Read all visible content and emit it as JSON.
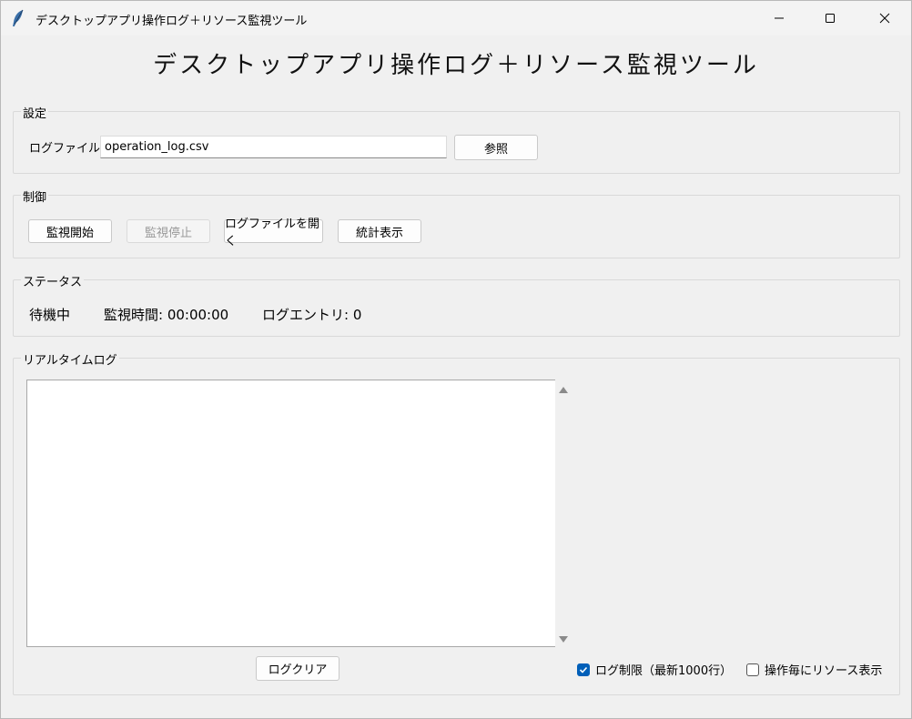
{
  "window": {
    "title": "デスクトップアプリ操作ログ＋リソース監視ツール"
  },
  "app_title": "デスクトップアプリ操作ログ＋リソース監視ツール",
  "settings": {
    "group_label": "設定",
    "logfile_label": "ログファイル:",
    "logfile_value": "operation_log.csv",
    "browse_label": "参照"
  },
  "control": {
    "group_label": "制御",
    "start_label": "監視開始",
    "stop_label": "監視停止",
    "open_log_label": "ログファイルを開く",
    "stats_label": "統計表示"
  },
  "status": {
    "group_label": "ステータス",
    "state": "待機中",
    "elapsed": "監視時間: 00:00:00",
    "entries": "ログエントリ: 0"
  },
  "realtime": {
    "group_label": "リアルタイムログ",
    "log_text": "",
    "clear_label": "ログクリア",
    "limit_label": "ログ制限（最新1000行）",
    "limit_checked": true,
    "resource_label": "操作毎にリソース表示",
    "resource_checked": false
  },
  "colors": {
    "accent": "#005fb8"
  }
}
